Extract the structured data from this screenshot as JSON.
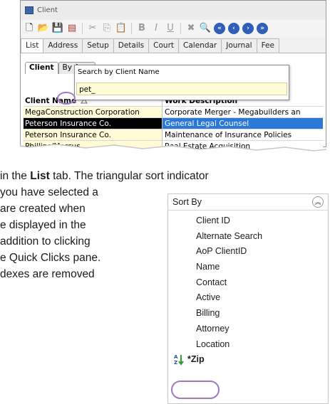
{
  "window": {
    "title": "Client",
    "tabs": [
      "List",
      "Address",
      "Setup",
      "Details",
      "Court",
      "Calendar",
      "Journal",
      "Fee"
    ],
    "subtabs": [
      "Client",
      "By Area"
    ],
    "search": {
      "label": "Search by Client Name",
      "value": "pet_"
    },
    "grid": {
      "headers": [
        "Client Name",
        "Work Description"
      ],
      "rows": [
        {
          "client": "MegaConstruction Corporation",
          "work": "Corporate Merger - Megabuilders an"
        },
        {
          "client": "Peterson Insurance Co.",
          "work": "General Legal Counsel"
        },
        {
          "client": "Peterson Insurance Co.",
          "work": "Maintenance of Insurance Policies"
        },
        {
          "client": "Phillips/Marcus",
          "work": "Real Estate Acquisition"
        }
      ]
    }
  },
  "body_text": {
    "line1_pre": "in the ",
    "line1_bold": "List",
    "line1_post": " tab. The triangular sort indicator",
    "line2": " you have selected a",
    "line3": " are created when",
    "line4": "e displayed in the",
    "line5": " addition to clicking",
    "line6": "e Quick Clicks pane.",
    "line7": "dexes are removed"
  },
  "sort_pane": {
    "title": "Sort By",
    "items": [
      "Client ID",
      "Alternate Search",
      "AoP ClientID",
      "Name",
      "Contact",
      "Active",
      "Billing",
      "Attorney",
      "Location"
    ],
    "active_item": "*Zip"
  },
  "colors": {
    "selected_row_left": "#000000",
    "selected_row_right": "#2b78d6",
    "highlight_yellow": "#fffbd6",
    "annotation_circle": "#a07ac0"
  }
}
